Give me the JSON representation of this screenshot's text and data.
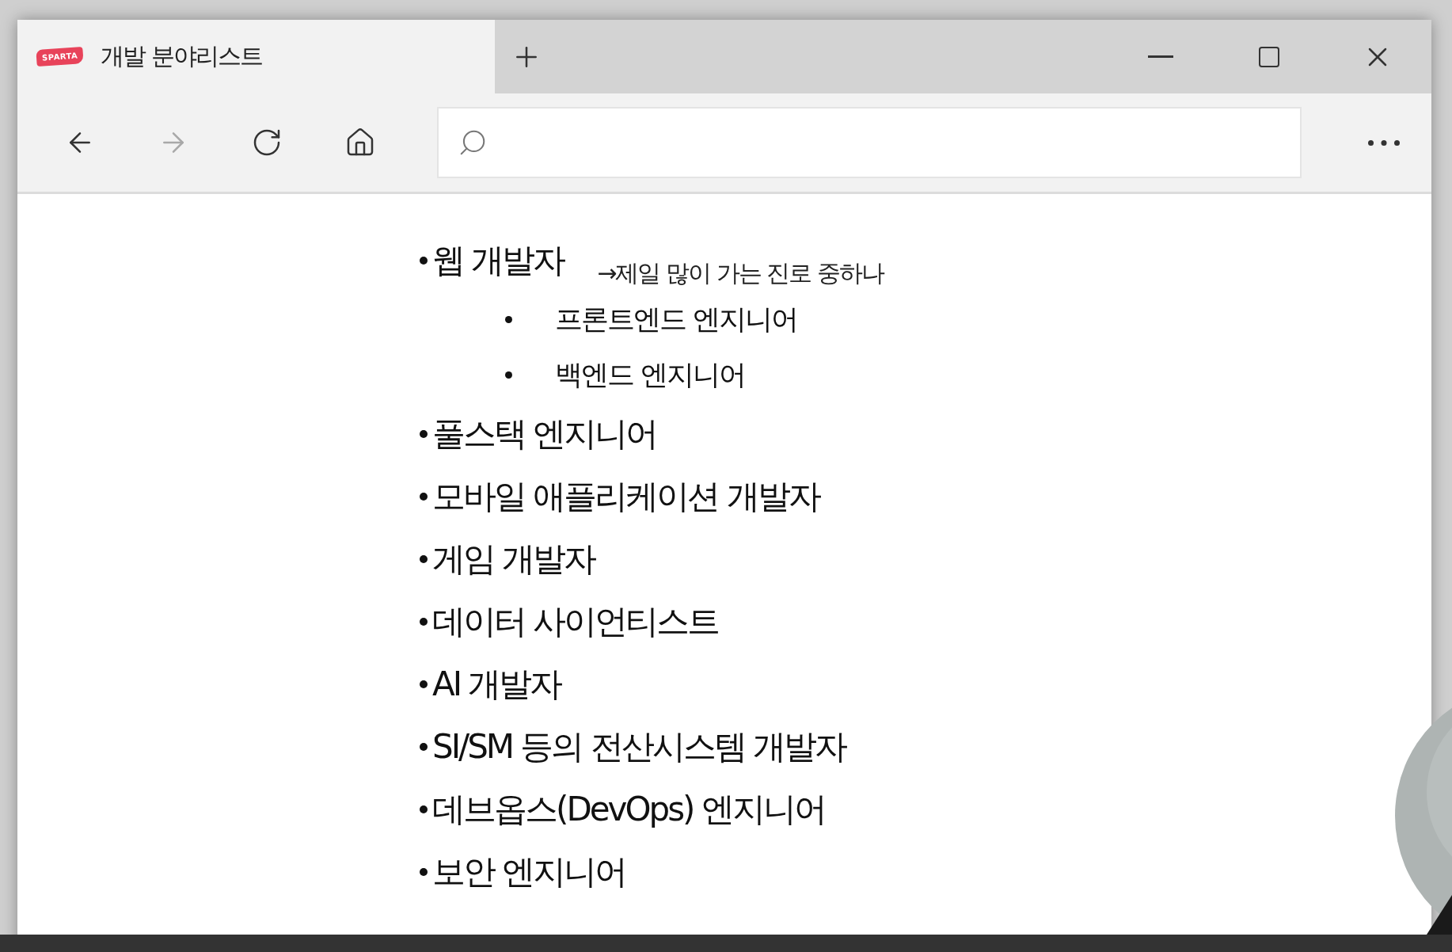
{
  "tab": {
    "logo_text": "SPARTA",
    "title": "개발 분야리스트",
    "selected": true
  },
  "toolbar": {
    "nav_buttons": [
      {
        "kind": "back",
        "disabled": false
      },
      {
        "kind": "forward",
        "disabled": true
      },
      {
        "kind": "refresh",
        "disabled": false
      },
      {
        "kind": "home",
        "disabled": false
      }
    ]
  },
  "list": [
    {
      "text": "웹 개발자",
      "note": "→제일 많이 가는 진로 중하나",
      "children": [
        {
          "text": "프론트엔드 엔지니어"
        },
        {
          "text": "백엔드 엔지니어"
        }
      ]
    },
    {
      "text": "풀스택 엔지니어"
    },
    {
      "text": "모바일 애플리케이션 개발자"
    },
    {
      "text": "게임 개발자"
    },
    {
      "text": "데이터 사이언티스트"
    },
    {
      "text": "AI 개발자"
    },
    {
      "text": "SI/SM 등의 전산시스템 개발자"
    },
    {
      "text": "데브옵스(DevOps) 엔지니어"
    },
    {
      "text": "보안 엔지니어"
    }
  ]
}
